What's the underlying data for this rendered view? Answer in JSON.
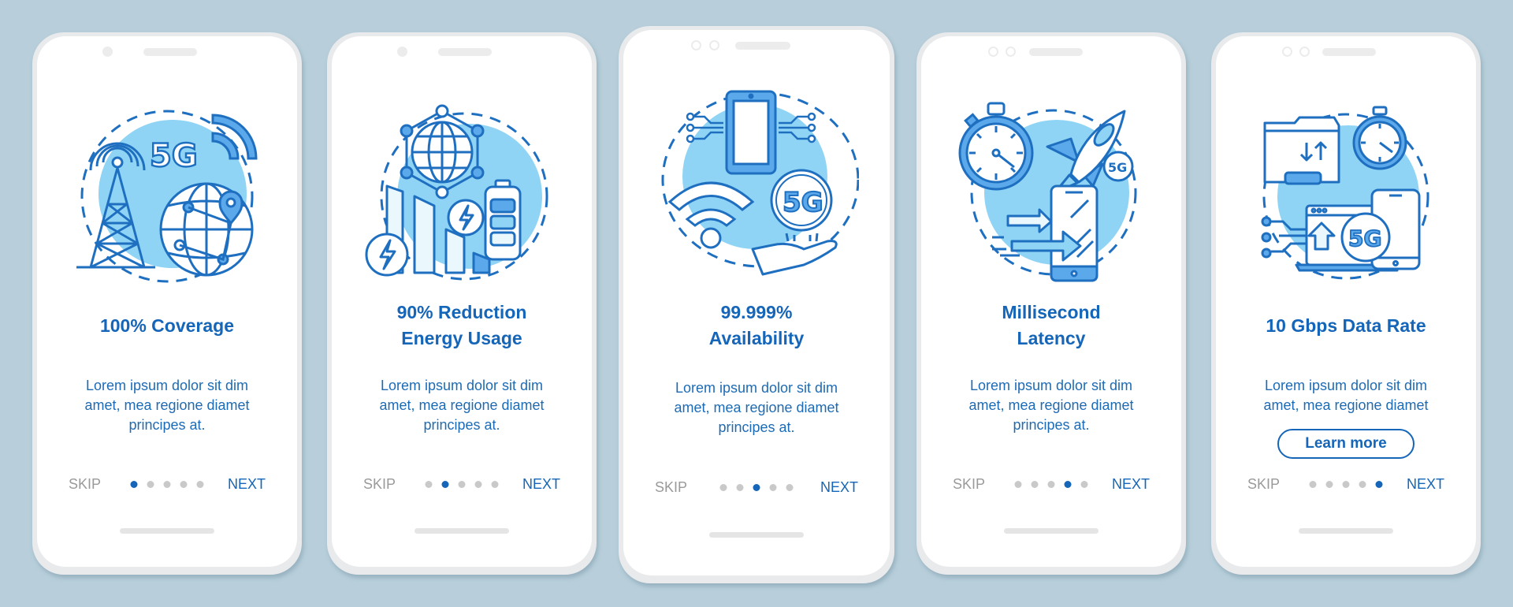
{
  "theme": {
    "background": "#b8cfdb",
    "accent": "#1565b8",
    "icon_stroke": "#1f6fc1",
    "icon_fill_light": "#8fd4f5",
    "icon_fill_medium": "#5ba8ea",
    "dot_inactive": "#c9c9c9",
    "skip_color": "#9a9a9a"
  },
  "screens": [
    {
      "icon": "5g-tower-globe-icon",
      "title_lines": [
        "100% Coverage"
      ],
      "body_lines": [
        "Lorem ipsum dolor sit dim",
        "amet, mea regione diamet",
        "principes at."
      ],
      "skip_label": "SKIP",
      "next_label": "NEXT",
      "page_index": 1,
      "page_count": 5
    },
    {
      "icon": "energy-reduction-icon",
      "title_lines": [
        "90% Reduction",
        "Energy Usage"
      ],
      "body_lines": [
        "Lorem ipsum dolor sit dim",
        "amet, mea regione diamet",
        "principes at."
      ],
      "skip_label": "SKIP",
      "next_label": "NEXT",
      "page_index": 2,
      "page_count": 5
    },
    {
      "icon": "availability-5g-icon",
      "title_lines": [
        "99.999%",
        "Availability"
      ],
      "body_lines": [
        "Lorem ipsum dolor sit dim",
        "amet, mea regione diamet",
        "principes at."
      ],
      "skip_label": "SKIP",
      "next_label": "NEXT",
      "page_index": 3,
      "page_count": 5
    },
    {
      "icon": "latency-stopwatch-rocket-icon",
      "title_lines": [
        "Millisecond",
        "Latency"
      ],
      "body_lines": [
        "Lorem ipsum dolor sit dim",
        "amet, mea regione diamet",
        "principes at."
      ],
      "skip_label": "SKIP",
      "next_label": "NEXT",
      "page_index": 4,
      "page_count": 5
    },
    {
      "icon": "data-rate-transfer-icon",
      "title_lines": [
        "10 Gbps Data Rate"
      ],
      "body_lines": [
        "Lorem ipsum dolor sit dim",
        "amet, mea regione diamet"
      ],
      "button_label": "Learn more",
      "skip_label": "SKIP",
      "next_label": "NEXT",
      "page_index": 5,
      "page_count": 5
    }
  ],
  "icon_text": {
    "fiveg": "5G"
  }
}
